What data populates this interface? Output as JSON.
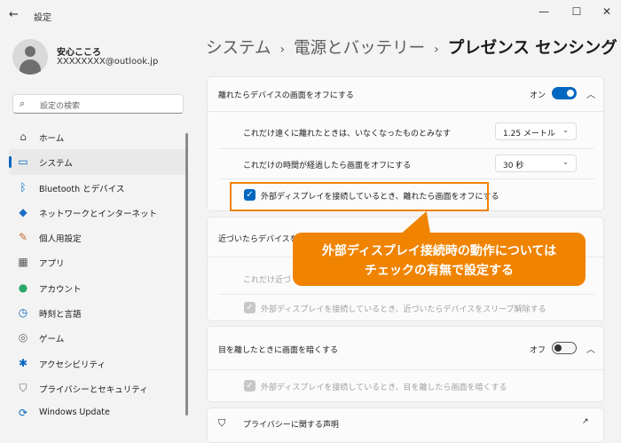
{
  "window": {
    "title": "設定",
    "back_glyph": "←",
    "minimize_glyph": "—",
    "maximize_glyph": "☐",
    "close_glyph": "✕"
  },
  "user": {
    "name": "安心こころ",
    "email": "XXXXXXXX@outlook.jp"
  },
  "search": {
    "placeholder": "設定の検索"
  },
  "sidebar": {
    "items": [
      {
        "label": "ホーム",
        "icon": "home-icon",
        "glyph": "⌂",
        "color": "#555555"
      },
      {
        "label": "システム",
        "icon": "system-icon",
        "glyph": "▭",
        "color": "#0067c0",
        "active": true
      },
      {
        "label": "Bluetooth とデバイス",
        "icon": "bluetooth-icon",
        "glyph": "ᛒ",
        "color": "#0067c0"
      },
      {
        "label": "ネットワークとインターネット",
        "icon": "network-icon",
        "glyph": "◆",
        "color": "#1a6fc4"
      },
      {
        "label": "個人用設定",
        "icon": "brush-icon",
        "glyph": "✎",
        "color": "#c36a2d"
      },
      {
        "label": "アプリ",
        "icon": "apps-icon",
        "glyph": "▦",
        "color": "#555555"
      },
      {
        "label": "アカウント",
        "icon": "account-icon",
        "glyph": "●",
        "color": "#2aa86a"
      },
      {
        "label": "時刻と言語",
        "icon": "clock-icon",
        "glyph": "◷",
        "color": "#0067c0"
      },
      {
        "label": "ゲーム",
        "icon": "game-icon",
        "glyph": "◎",
        "color": "#666666"
      },
      {
        "label": "アクセシビリティ",
        "icon": "accessibility-icon",
        "glyph": "✱",
        "color": "#0067c0"
      },
      {
        "label": "プライバシーとセキュリティ",
        "icon": "shield-icon",
        "glyph": "⛉",
        "color": "#666666"
      },
      {
        "label": "Windows Update",
        "icon": "update-icon",
        "glyph": "⟳",
        "color": "#0067c0"
      }
    ]
  },
  "breadcrumb": {
    "part1": "システム",
    "part2": "電源とバッテリー",
    "current": "プレゼンス センシング",
    "separator": "›"
  },
  "lock_section": {
    "title": "離れたらデバイスの画面をオフにする",
    "toggle_label": "オン",
    "toggle_on": true,
    "distance_label": "これだけ遠くに離れたときは、いなくなったものとみなす",
    "distance_value": "1.25 メートル",
    "time_label": "これだけの時間が経過したら画面をオフにする",
    "time_value": "30 秒",
    "checkbox_label": "外部ディスプレイを接続しているとき、離れたら画面をオフにする",
    "checkbox_checked": true
  },
  "wake_section": {
    "title": "近づいたらデバイスをスリ",
    "distance_label": "これだけ近づ",
    "checkbox_label": "外部ディスプレイを接続しているとき、近づいたらデバイスをスリープ解除する"
  },
  "dim_section": {
    "title": "目を離したときに画面を暗くする",
    "toggle_label": "オフ",
    "toggle_on": false,
    "checkbox_label": "外部ディスプレイを接続しているとき、目を離したら画面を暗くする"
  },
  "privacy_link": {
    "label": "プライバシーに関する声明"
  },
  "callout": {
    "line1": "外部ディスプレイ接続時の動作については",
    "line2": "チェックの有無で設定する"
  },
  "colors": {
    "accent": "#0067c0",
    "callout": "#f08300"
  }
}
